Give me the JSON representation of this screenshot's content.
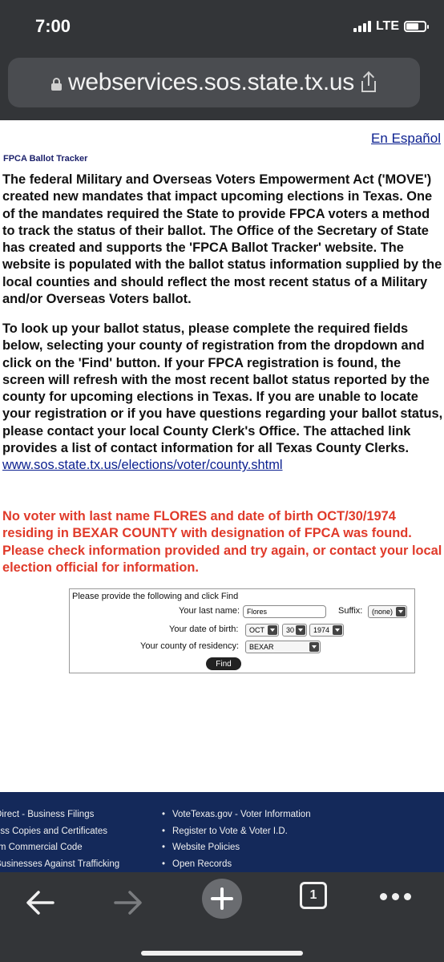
{
  "status_bar": {
    "time": "7:00",
    "network": "LTE"
  },
  "browser": {
    "url": "webservices.sos.state.tx.us",
    "tab_count": "1"
  },
  "page": {
    "lang_link": "En Español",
    "tracker_title": "FPCA Ballot Tracker",
    "intro": "The federal Military and Overseas Voters Empowerment Act ('MOVE') created new mandates that impact upcoming elections in Texas. One of the mandates required the State to provide FPCA voters a method to track the status of their ballot. The Office of the Secretary of State has created and supports the 'FPCA Ballot Tracker' website. The website is populated with the ballot status information supplied by the local counties and should reflect the most recent status of a Military and/or Overseas Voters ballot.",
    "lookup": "To look up your ballot status, please complete the required fields below, selecting your county of registration from the dropdown and click on the 'Find' button. If your FPCA registration is found, the screen will refresh with the most recent ballot status reported by the county for upcoming elections in Texas. If you are unable to locate your registration or if you have questions regarding your ballot status, please contact your local County Clerk's Office. The attached link provides a list of contact information for all Texas County Clerks.",
    "county_link": "www.sos.state.tx.us/elections/voter/county.shtml",
    "error": "No voter with last name FLORES and date of birth OCT/30/1974 residing in BEXAR COUNTY with designation of FPCA was found. Please check information provided and try again, or contact your local election official for information."
  },
  "form": {
    "heading": "Please provide the following and click Find",
    "last_name_label": "Your last name:",
    "last_name_value": "Flores",
    "suffix_label": "Suffix:",
    "suffix_value": "(none)",
    "dob_label": "Your date of birth:",
    "dob_month": "OCT",
    "dob_day": "30",
    "dob_year": "1974",
    "county_label": "Your county of residency:",
    "county_value": "BEXAR",
    "find_label": "Find"
  },
  "footer": {
    "left": [
      "Direct - Business Filings",
      "ess Copies and Certificates",
      "rm Commercial Code",
      "Businesses Against Trafficking"
    ],
    "right": [
      "VoteTexas.gov - Voter Information",
      "Register to Vote & Voter I.D.",
      "Website Policies",
      "Open Records"
    ]
  }
}
